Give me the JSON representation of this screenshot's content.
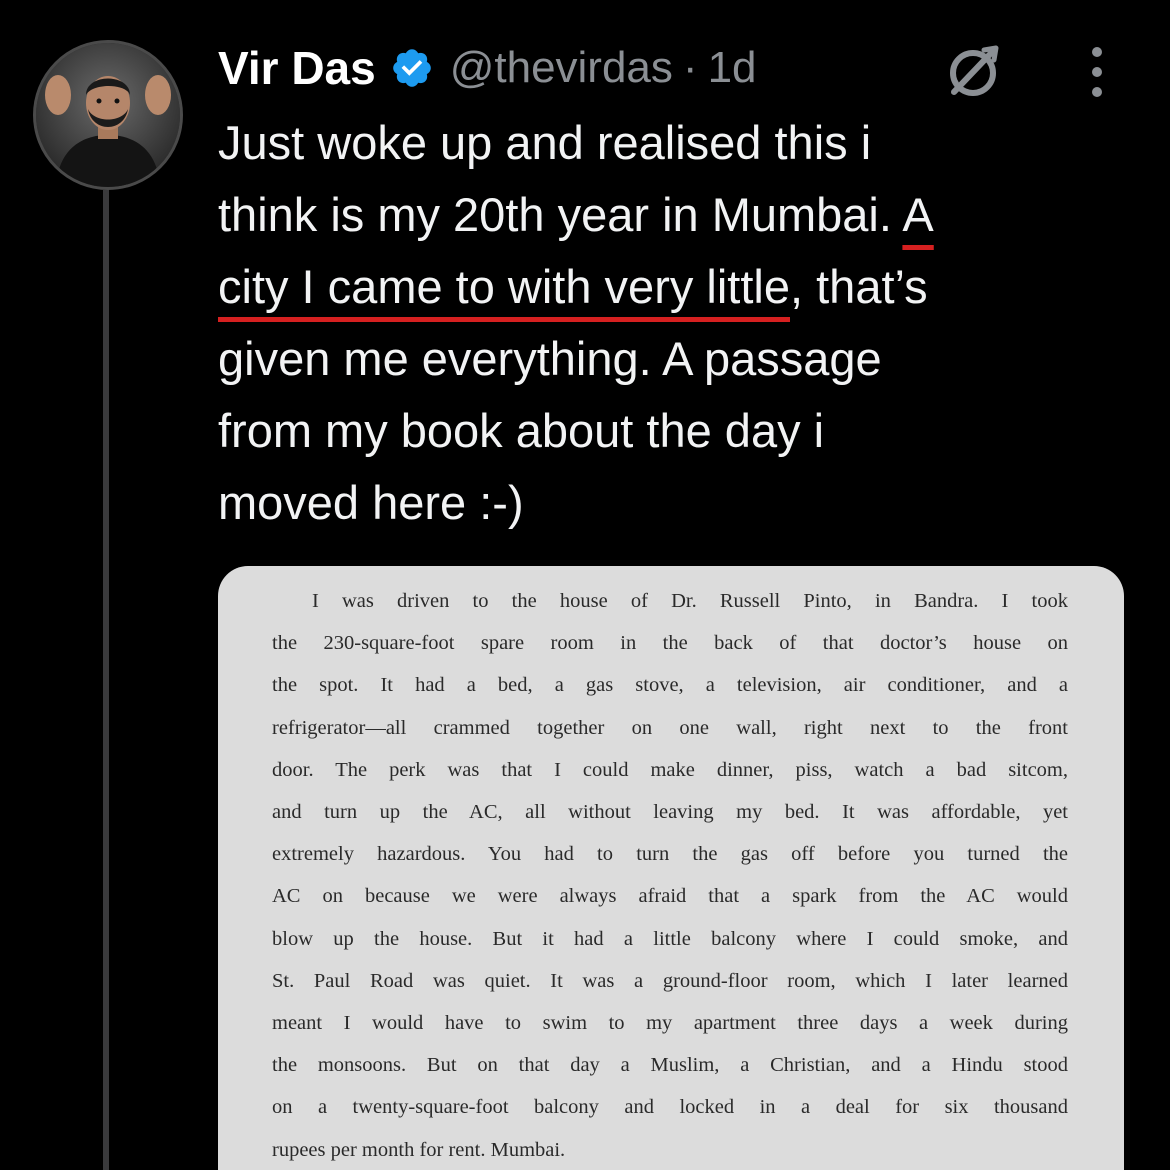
{
  "author": {
    "display_name": "Vir Das",
    "handle": "@thevirdas",
    "separator": "·",
    "time": "1d",
    "verified_color": "#1d9bf0"
  },
  "tweet": {
    "lines": [
      {
        "text": "Just woke up and realised this i",
        "underlined": ""
      },
      {
        "text": "think is my 20th year in Mumbai. ",
        "underlined": "A"
      },
      {
        "text": "",
        "underlined": "city I came to with very little",
        "after": ", that’s"
      },
      {
        "text": "given me everything. A passage"
      },
      {
        "text": "from my book about the day i"
      },
      {
        "text": "moved here :-)"
      }
    ],
    "highlight_color": "#d62020"
  },
  "media": {
    "passage_lines": [
      "I was driven to the house of Dr. Russell Pinto, in Bandra. I took",
      "the 230-square-foot spare room in the back of that doctor’s house on",
      "the spot. It had a bed, a gas stove, a television, air conditioner, and a",
      "refrigerator—all crammed together on one wall, right next to the front",
      "door. The perk was that I could make dinner, piss, watch a bad sitcom,",
      "and turn up the AC, all without leaving my bed. It was affordable, yet",
      "extremely hazardous. You had to turn the gas off before you turned the",
      "AC on because we were always afraid that a spark from the AC would",
      "blow up the house. But it had a little balcony where I could smoke, and",
      "St. Paul Road was quiet. It was a ground-floor room, which I later learned",
      "meant I would have to swim to my apartment three days a week during",
      "the monsoons. But on that day a Muslim, a Christian, and a Hindu stood",
      "on a twenty-square-foot balcony and locked in a deal for six thousand",
      "rupees per month for rent. Mumbai."
    ]
  },
  "icons": {
    "verified": "verified-badge-icon",
    "grok": "grok-icon",
    "more": "more-vertical-icon"
  }
}
